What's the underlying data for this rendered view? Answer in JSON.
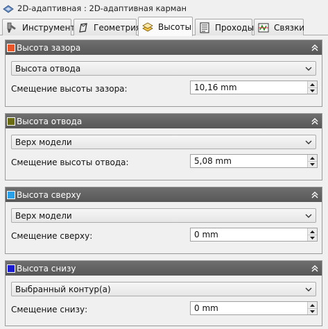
{
  "window": {
    "title": "2D-адаптивная : 2D-адаптивная карман"
  },
  "tabs": [
    {
      "label": "Инструмент"
    },
    {
      "label": "Геометрия"
    },
    {
      "label": "Высоты"
    },
    {
      "label": "Проходы"
    },
    {
      "label": "Связки"
    }
  ],
  "active_tab": "Высоты",
  "sections": [
    {
      "title": "Высота зазора",
      "color": "#e8562a",
      "dropdown_value": "Высота отвода",
      "offset_label": "Смещение высоты зазора:",
      "offset_value": "10,16 mm"
    },
    {
      "title": "Высота отвода",
      "color": "#6b6b12",
      "dropdown_value": "Верх модели",
      "offset_label": "Смещение высоты отвода:",
      "offset_value": "5,08 mm"
    },
    {
      "title": "Высота сверху",
      "color": "#2aa0e8",
      "dropdown_value": "Верх модели",
      "offset_label": "Смещение сверху:",
      "offset_value": "0 mm"
    },
    {
      "title": "Высота снизу",
      "color": "#1a1ad0",
      "dropdown_value": "Выбранный контур(а)",
      "offset_label": "Смещение снизу:",
      "offset_value": "0 mm"
    }
  ]
}
